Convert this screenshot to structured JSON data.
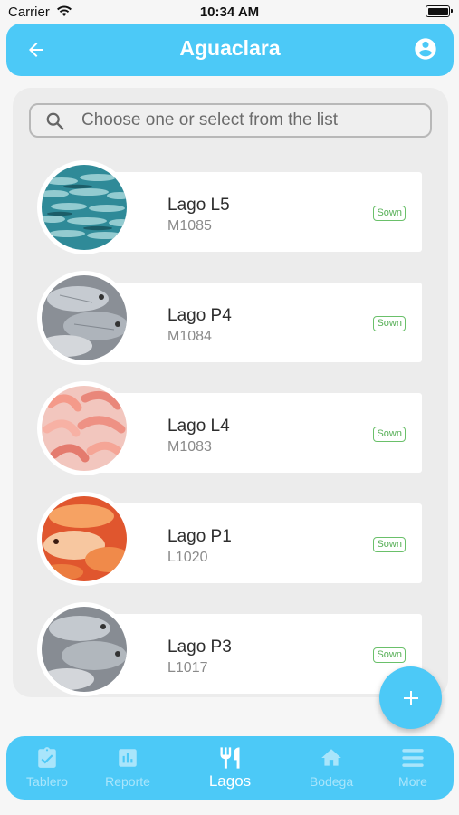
{
  "status_bar": {
    "carrier": "Carrier",
    "time": "10:34 AM"
  },
  "app_bar": {
    "title": "Aguaclara",
    "back_icon": "arrow-left-icon",
    "account_icon": "account-circle-icon"
  },
  "search": {
    "placeholder": "Choose one or select from the list",
    "value": ""
  },
  "lakes": [
    {
      "name": "Lago L5",
      "code": "M1085",
      "status": "Sown",
      "image": "fish-school"
    },
    {
      "name": "Lago P4",
      "code": "M1084",
      "status": "Sown",
      "image": "tilapia"
    },
    {
      "name": "Lago L4",
      "code": "M1083",
      "status": "Sown",
      "image": "shrimp"
    },
    {
      "name": "Lago P1",
      "code": "L1020",
      "status": "Sown",
      "image": "red-tilapia"
    },
    {
      "name": "Lago P3",
      "code": "L1017",
      "status": "Sown",
      "image": "tilapia"
    }
  ],
  "fab": {
    "icon": "plus-icon"
  },
  "bottom_nav": {
    "items": [
      {
        "label": "Tablero",
        "icon": "clipboard-check-icon",
        "active": false
      },
      {
        "label": "Reporte",
        "icon": "bar-chart-icon",
        "active": false
      },
      {
        "label": "Lagos",
        "icon": "fork-knife-icon",
        "active": true
      },
      {
        "label": "Bodega",
        "icon": "home-icon",
        "active": false
      },
      {
        "label": "More",
        "icon": "menu-icon",
        "active": false
      }
    ]
  },
  "colors": {
    "primary": "#4cc9f7",
    "panel": "#ececec",
    "badge": "#58b058"
  }
}
